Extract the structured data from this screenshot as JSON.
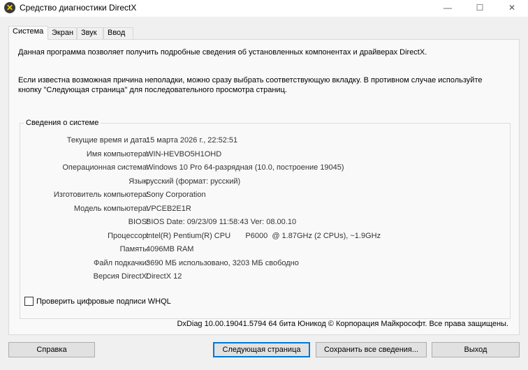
{
  "window": {
    "title": "Средство диагностики DirectX",
    "minimize": "—",
    "maximize": "☐",
    "close": "✕"
  },
  "tabs": [
    {
      "label": "Система"
    },
    {
      "label": "Экран"
    },
    {
      "label": "Звук"
    },
    {
      "label": "Ввод"
    }
  ],
  "intro": "Данная программа позволяет получить подробные сведения об установленных компонентах и драйверах DirectX.",
  "hint": "Если известна возможная причина неполадки, можно сразу выбрать соответствующую вкладку. В противном случае используйте кнопку \"Следующая страница\" для последовательного просмотра страниц.",
  "system": {
    "title": "Сведения о системе",
    "rows": [
      {
        "label": "Текущие время и дата:",
        "value": "15 марта 2026 г., 22:52:51"
      },
      {
        "label": "Имя компьютера:",
        "value": "WIN-HEVBO5H1OHD"
      },
      {
        "label": "Операционная система:",
        "value": "Windows 10 Pro 64-разрядная (10.0, построение 19045)"
      },
      {
        "label": "Язык:",
        "value": "русский (формат: русский)"
      },
      {
        "label": "Изготовитель компьютера:",
        "value": "Sony Corporation"
      },
      {
        "label": "Модель компьютера:",
        "value": "VPCEB2E1R"
      },
      {
        "label": "BIOS:",
        "value": "BIOS Date: 09/23/09 11:58:43 Ver: 08.00.10"
      },
      {
        "label": "Процессор:",
        "value": "Intel(R) Pentium(R) CPU       P6000  @ 1.87GHz (2 CPUs), ~1.9GHz"
      },
      {
        "label": "Память:",
        "value": "4096MB RAM"
      },
      {
        "label": "Файл подкачки:",
        "value": "3690 МБ использовано, 3203 МБ свободно"
      },
      {
        "label": "Версия DirectX:",
        "value": "DirectX 12"
      }
    ]
  },
  "whql": {
    "label": "Проверить цифровые подписи WHQL",
    "checked": false
  },
  "footer": "DxDiag 10.00.19041.5794 64 бита Юникод © Корпорация Майкрософт. Все права защищены.",
  "buttons": {
    "help": "Справка",
    "next": "Следующая страница",
    "save": "Сохранить все сведения...",
    "exit": "Выход"
  }
}
